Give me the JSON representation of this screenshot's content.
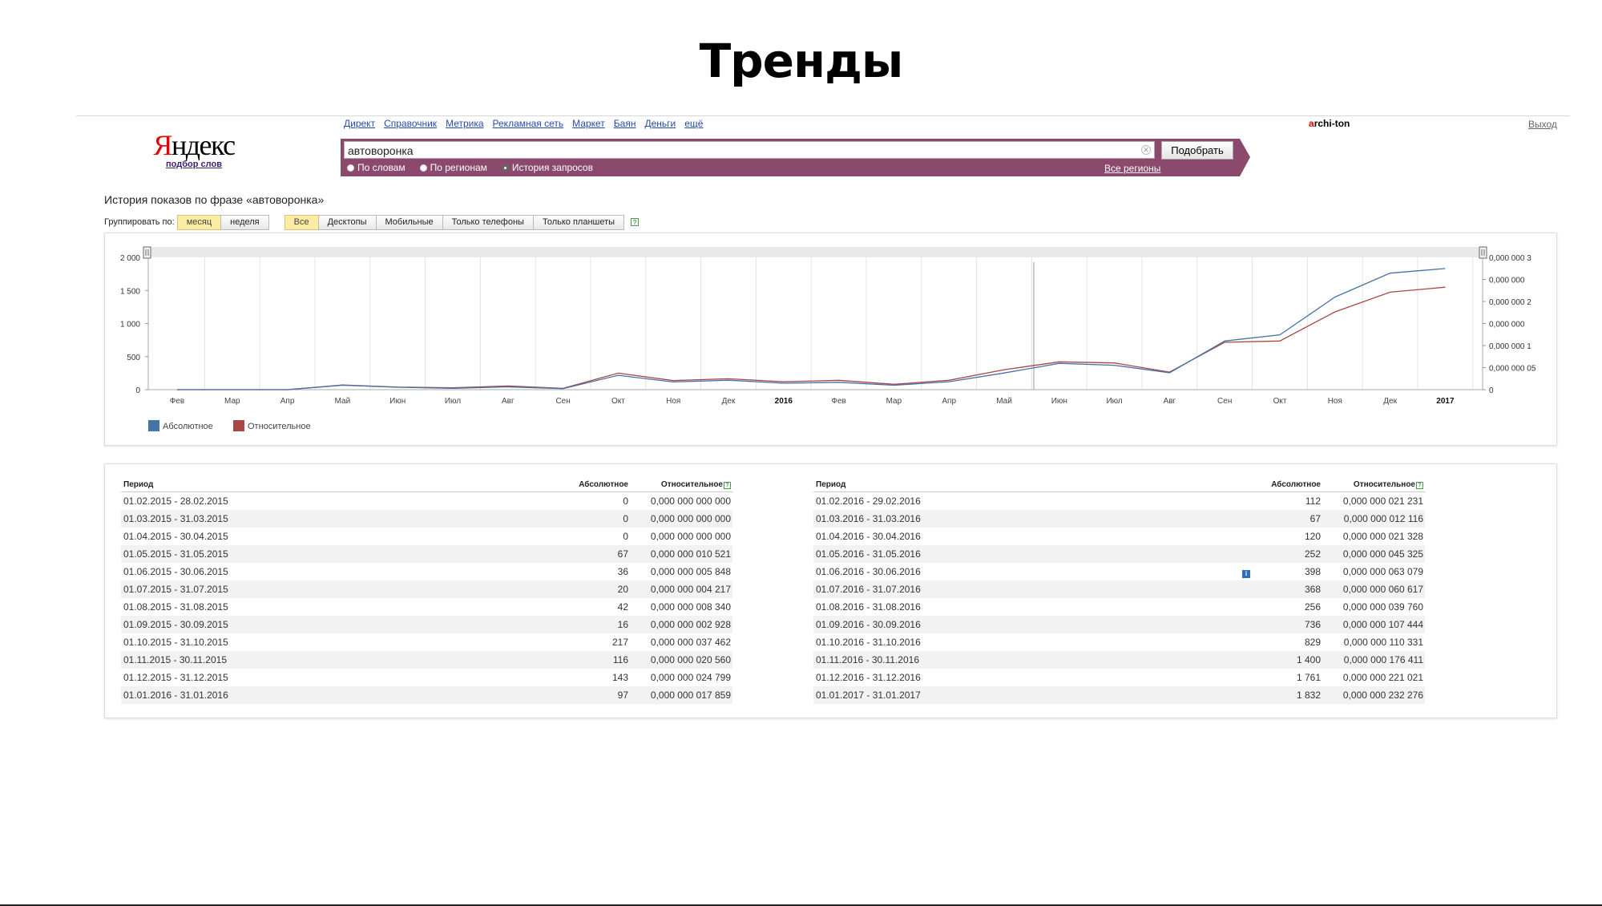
{
  "slide": {
    "title": "Тренды"
  },
  "logo": {
    "brand_first": "Я",
    "brand_rest": "ндекс",
    "sub": "подбор слов"
  },
  "nav": {
    "items": [
      "Директ",
      "Справочник",
      "Метрика",
      "Рекламная сеть",
      "Маркет",
      "Баян",
      "Деньги",
      "ещё"
    ]
  },
  "user": {
    "first": "a",
    "rest": "rchi-ton",
    "logout": "Выход"
  },
  "search": {
    "value": "автоворонка",
    "submit": "Подобрать",
    "modes": [
      "По словам",
      "По регионам",
      "История запросов"
    ],
    "selected_mode": 2,
    "regions_link": "Все регионы"
  },
  "history": {
    "phrase_label": "История показов по фразе «автоворонка»",
    "group_label": "Группировать по:",
    "group_options": [
      "месяц",
      "неделя"
    ],
    "device_options": [
      "Все",
      "Десктопы",
      "Мобильные",
      "Только телефоны",
      "Только планшеты"
    ],
    "group_active": 0,
    "device_active": 0,
    "help": "?"
  },
  "chart_data": {
    "type": "line",
    "x": [
      "Фев",
      "Мар",
      "Апр",
      "Май",
      "Июн",
      "Июл",
      "Авг",
      "Сен",
      "Окт",
      "Ноя",
      "Дек",
      "2016",
      "Фев",
      "Мар",
      "Апр",
      "Май",
      "Июн",
      "Июл",
      "Авг",
      "Сен",
      "Окт",
      "Ноя",
      "Дек",
      "2017"
    ],
    "bold_ticks": [
      "2016",
      "2017"
    ],
    "series": [
      {
        "name": "Абсолютное",
        "color": "#4572a7",
        "values": [
          0,
          0,
          0,
          67,
          36,
          20,
          42,
          16,
          217,
          116,
          143,
          97,
          112,
          67,
          120,
          252,
          398,
          368,
          256,
          736,
          829,
          1400,
          1761,
          1832
        ]
      },
      {
        "name": "Относительное",
        "color": "#aa4643",
        "values": [
          0.0,
          0.0,
          0.0,
          1.0521e-08,
          5.848e-09,
          4.217e-09,
          8.34e-09,
          2.928e-09,
          3.7462e-08,
          2.056e-08,
          2.4799e-08,
          1.7859e-08,
          2.1231e-08,
          1.2116e-08,
          2.1328e-08,
          4.5325e-08,
          6.3079e-08,
          6.0617e-08,
          3.976e-08,
          1.07444e-07,
          1.10331e-07,
          1.76411e-07,
          2.21021e-07,
          2.32276e-07
        ]
      }
    ],
    "ylim": [
      0,
      2000
    ],
    "y_ticks": [
      "0",
      "500",
      "1 000",
      "1 500",
      "2 000"
    ],
    "y2lim": [
      0,
      3e-07
    ],
    "y2_ticks": [
      "0",
      "0,000 000 05",
      "0,000 000 1",
      "0,000 000",
      "0,000 000 2",
      "0,000 000",
      "0,000 000 3"
    ],
    "grid": true,
    "legend": "bottom-left"
  },
  "table": {
    "headers": [
      "Период",
      "Абсолютное",
      "Относительное"
    ],
    "help": "?",
    "info": "i",
    "left": [
      {
        "period": "01.02.2015 - 28.02.2015",
        "abs": "0",
        "rel": "0,000 000 000 000"
      },
      {
        "period": "01.03.2015 - 31.03.2015",
        "abs": "0",
        "rel": "0,000 000 000 000"
      },
      {
        "period": "01.04.2015 - 30.04.2015",
        "abs": "0",
        "rel": "0,000 000 000 000"
      },
      {
        "period": "01.05.2015 - 31.05.2015",
        "abs": "67",
        "rel": "0,000 000 010 521"
      },
      {
        "period": "01.06.2015 - 30.06.2015",
        "abs": "36",
        "rel": "0,000 000 005 848"
      },
      {
        "period": "01.07.2015 - 31.07.2015",
        "abs": "20",
        "rel": "0,000 000 004 217"
      },
      {
        "period": "01.08.2015 - 31.08.2015",
        "abs": "42",
        "rel": "0,000 000 008 340"
      },
      {
        "period": "01.09.2015 - 30.09.2015",
        "abs": "16",
        "rel": "0,000 000 002 928"
      },
      {
        "period": "01.10.2015 - 31.10.2015",
        "abs": "217",
        "rel": "0,000 000 037 462"
      },
      {
        "period": "01.11.2015 - 30.11.2015",
        "abs": "116",
        "rel": "0,000 000 020 560"
      },
      {
        "period": "01.12.2015 - 31.12.2015",
        "abs": "143",
        "rel": "0,000 000 024 799"
      },
      {
        "period": "01.01.2016 - 31.01.2016",
        "abs": "97",
        "rel": "0,000 000 017 859"
      }
    ],
    "right": [
      {
        "period": "01.02.2016 - 29.02.2016",
        "abs": "112",
        "rel": "0,000 000 021 231"
      },
      {
        "period": "01.03.2016 - 31.03.2016",
        "abs": "67",
        "rel": "0,000 000 012 116"
      },
      {
        "period": "01.04.2016 - 30.04.2016",
        "abs": "120",
        "rel": "0,000 000 021 328"
      },
      {
        "period": "01.05.2016 - 31.05.2016",
        "abs": "252",
        "rel": "0,000 000 045 325"
      },
      {
        "period": "01.06.2016 - 30.06.2016",
        "abs": "398",
        "rel": "0,000 000 063 079",
        "info": true
      },
      {
        "period": "01.07.2016 - 31.07.2016",
        "abs": "368",
        "rel": "0,000 000 060 617"
      },
      {
        "period": "01.08.2016 - 31.08.2016",
        "abs": "256",
        "rel": "0,000 000 039 760"
      },
      {
        "period": "01.09.2016 - 30.09.2016",
        "abs": "736",
        "rel": "0,000 000 107 444"
      },
      {
        "period": "01.10.2016 - 31.10.2016",
        "abs": "829",
        "rel": "0,000 000 110 331"
      },
      {
        "period": "01.11.2016 - 30.11.2016",
        "abs": "1 400",
        "rel": "0,000 000 176 411"
      },
      {
        "period": "01.12.2016 - 31.12.2016",
        "abs": "1 761",
        "rel": "0,000 000 221 021"
      },
      {
        "period": "01.01.2017 - 31.01.2017",
        "abs": "1 832",
        "rel": "0,000 000 232 276"
      }
    ]
  }
}
